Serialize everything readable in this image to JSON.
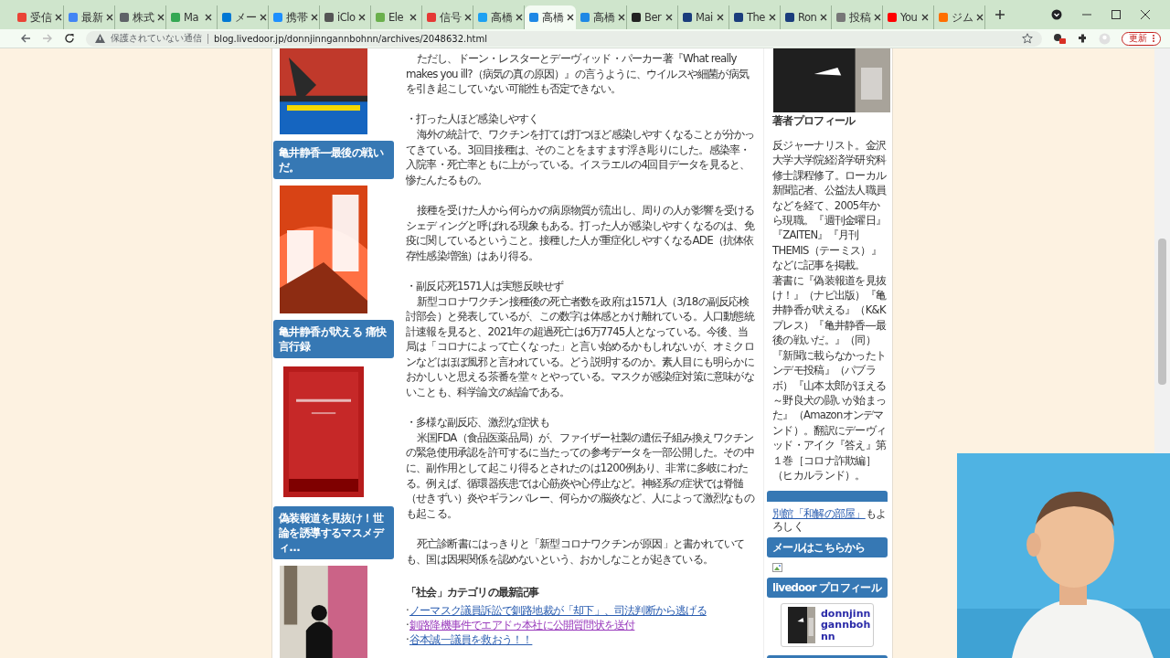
{
  "browser": {
    "tabs": [
      {
        "label": "受信",
        "selected": false,
        "color": "#ea4335"
      },
      {
        "label": "最新",
        "selected": false,
        "color": "#4285f4"
      },
      {
        "label": "株式",
        "selected": false,
        "color": "#5f6368"
      },
      {
        "label": "Ma",
        "selected": false,
        "color": "#34a853"
      },
      {
        "label": "メー",
        "selected": false,
        "color": "#0078d4"
      },
      {
        "label": "携帯",
        "selected": false,
        "color": "#1e90ff"
      },
      {
        "label": "iClo",
        "selected": false,
        "color": "#555555"
      },
      {
        "label": "Ele",
        "selected": false,
        "color": "#6ab04c"
      },
      {
        "label": "信号",
        "selected": false,
        "color": "#e53935"
      },
      {
        "label": "高橋",
        "selected": false,
        "color": "#1da1f2"
      },
      {
        "label": "高橋",
        "selected": true,
        "color": "#1e88e5"
      },
      {
        "label": "高橋",
        "selected": false,
        "color": "#1e88e5"
      },
      {
        "label": "Ber",
        "selected": false,
        "color": "#222222"
      },
      {
        "label": "Mai",
        "selected": false,
        "color": "#1a3d7c"
      },
      {
        "label": "The",
        "selected": false,
        "color": "#1a3d7c"
      },
      {
        "label": "Ron",
        "selected": false,
        "color": "#1a3d7c"
      },
      {
        "label": "投稿",
        "selected": false,
        "color": "#777777"
      },
      {
        "label": "You",
        "selected": false,
        "color": "#ff0000"
      },
      {
        "label": "ジム",
        "selected": false,
        "color": "#ff6f00"
      }
    ],
    "security": "保護されていない通信",
    "url": "blog.livedoor.jp/donnjinngannbohnn/archives/2048632.html",
    "update_button": "更新"
  },
  "left_sidebar": [
    {
      "kind": "picture"
    },
    {
      "kind": "heading",
      "text": "亀井静香―最後の戦いだ。"
    },
    {
      "kind": "picture"
    },
    {
      "kind": "heading",
      "text": "亀井静香が吠える 痛快言行録"
    },
    {
      "kind": "picture"
    },
    {
      "kind": "heading",
      "text": "偽装報道を見抜け！世論を誘導するマスメディ…"
    },
    {
      "kind": "picture"
    }
  ],
  "article": {
    "paragraphs": [
      {
        "text": "ただし、ドーン・レスターとデーヴィッド・パーカー著『What really makes you ill?（病気の真の原因）』の言うように、ウイルスや細菌が病気を引き起こしていない可能性も否定できない。"
      },
      {
        "heading": "・打った人ほど感染しやすく",
        "text": "海外の統計で、ワクチンを打てば打つほど感染しやすくなることが分かってきている。3回目接種は、そのことをますます浮き彫りにした。感染率・入院率・死亡率ともに上がっている。イスラエルの4回目データを見ると、惨たんたるもの。"
      },
      {
        "text": "接種を受けた人から何らかの病原物質が流出し、周りの人が影響を受けるシェディングと呼ばれる現象もある。打った人が感染しやすくなるのは、免疫に関しているということ。接種した人が重症化しやすくなるADE（抗体依存性感染増強）はあり得る。"
      },
      {
        "heading": "・副反応死1571人は実態反映せず",
        "text": "新型コロナワクチン接種後の死亡者数を政府は1571人（3/18の副反応検討部会）と発表しているが、この数字は体感とかけ離れている。人口動態統計速報を見ると、2021年の超過死亡は6万7745人となっている。今後、当局は「コロナによって亡くなった」と言い始めるかもしれないが、オミクロンなどはほぼ風邪と言われている。どう説明するのか。素人目にも明らかにおかしいと思える茶番を堂々とやっている。マスクが感染症対策に意味がないことも、科学論文の結論である。"
      },
      {
        "heading": "・多様な副反応、激烈な症状も",
        "text": "米国FDA（食品医薬品局）が、ファイザー社製の遺伝子組み換えワクチンの緊急使用承認を許可するに当たっての参考データを一部公開した。その中に、副作用として起こり得るとされたのは1200例あり、非常に多岐にわたる。例えば、循環器疾患では心筋炎や心停止など。神経系の症状では脊髄（せきずい）炎やギランバレー、何らかの脳炎など、人によって激烈なものも起こる。"
      },
      {
        "text": "死亡診断書にはっきりと「新型コロナワクチンが原因」と書かれていても、国は因果関係を認めないという、おかしなことが起きている。"
      }
    ]
  },
  "related": {
    "title": "「社会」カテゴリの最新記事",
    "links": [
      {
        "marker": "·",
        "text": "ノーマスク議員訴訟で釧路地裁が「却下」、司法判断から逃げる",
        "visited": false
      },
      {
        "marker": "·",
        "text": "釧路降機事件でエアドゥ本社に公開質問状を送付",
        "visited": true
      },
      {
        "marker": "·",
        "text": "谷本誠一議員を救おう！！",
        "visited": false
      }
    ]
  },
  "right_sidebar": [
    {
      "kind": "picture"
    },
    {
      "kind": "title",
      "text": "著者プロフィール"
    },
    {
      "kind": "paragraph",
      "text": "反ジャーナリスト。金沢大学大学院経済学研究科修士課程修了。ローカル新聞記者、公益法人職員などを経て、2005年から現職。『週刊金曜日』『ZAITEN』『月刊THEMIS（テーミス）』などに記事を掲載。"
    },
    {
      "kind": "paragraph",
      "text": "著書に『偽装報道を見抜け！』（ナビ出版）『亀井静香が吠える』（K&Kプレス）『亀井静香―最後の戦いだ。』（同）『新聞に載らなかったトンデモ投稿』（パブラボ）『山本太郎がほえる～野良犬の闘いが始まった』（Amazonオンデマンド）。翻訳にデーヴィッド・アイク『答え』第１巻［コロナ詐欺編］（ヒカルランド）。"
    },
    {
      "kind": "bar"
    },
    {
      "kind": "link_text",
      "link": "別館「和解の部屋」",
      "text": "もよろしく"
    },
    {
      "kind": "heading",
      "text": "メールはこちらから"
    },
    {
      "kind": "broken_image"
    },
    {
      "kind": "heading",
      "text": "livedoor プロフィール"
    },
    {
      "kind": "profile",
      "name": "donnjinngannbohnn"
    },
    {
      "kind": "bar"
    }
  ],
  "video_overlay": {
    "kind": "picture"
  }
}
